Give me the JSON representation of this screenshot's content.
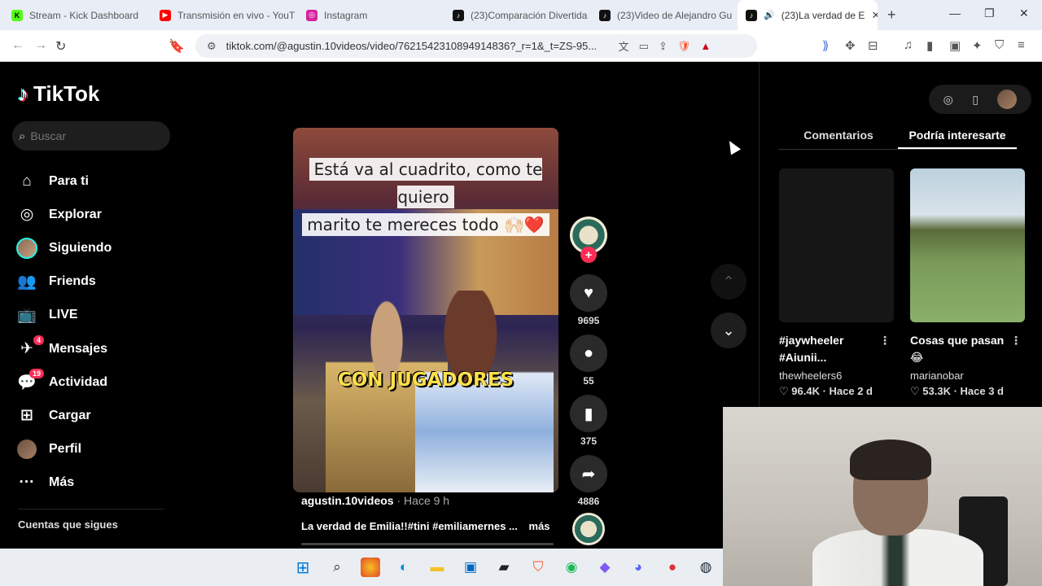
{
  "browser": {
    "tabs": [
      {
        "title": "Stream - Kick Dashboard",
        "fav_color": "#53fc18",
        "fav": "K"
      },
      {
        "title": "Transmisión en vivo - YouT",
        "fav_color": "#ff0000",
        "fav": "▶"
      },
      {
        "title": "Instagram",
        "fav_color": "#d6249f",
        "fav": "◎"
      },
      {
        "title": "(23)Comparación Divertida",
        "fav_color": "#111111",
        "fav": "♪"
      },
      {
        "title": "(23)Video de Alejandro Gu",
        "fav_color": "#111111",
        "fav": "♪"
      },
      {
        "title": "(23)La verdad de E",
        "fav_color": "#111111",
        "fav": "♪"
      }
    ],
    "url": "tiktok.com/@agustin.10videos/video/7621542310894914836?_r=1&_t=ZS-95..."
  },
  "tiktok": {
    "logo": "TikTok",
    "search_placeholder": "Buscar",
    "nav": [
      {
        "label": "Para ti",
        "icon": "⌂"
      },
      {
        "label": "Explorar",
        "icon": "◎"
      },
      {
        "label": "Siguiendo",
        "icon": ""
      },
      {
        "label": "Friends",
        "icon": "👥"
      },
      {
        "label": "LIVE",
        "icon": "📺"
      },
      {
        "label": "Mensajes",
        "icon": "✈",
        "badge": "4"
      },
      {
        "label": "Actividad",
        "icon": "💬",
        "badge": "19"
      },
      {
        "label": "Cargar",
        "icon": "⊞"
      },
      {
        "label": "Perfil",
        "icon": ""
      },
      {
        "label": "Más",
        "icon": "···"
      }
    ],
    "following_title": "Cuentas que sigues"
  },
  "video": {
    "caption_line1": "Está va al cuadrito, como te quiero",
    "caption_line2": "marito te mereces todo 🙌🏻❤️",
    "overlay_text": "CON JUGADORES",
    "author": "agustin.10videos",
    "time": "Hace 9 h",
    "description": "La verdad de Emilia!!#tini #emiliamernes ...",
    "more": "más",
    "likes": "9695",
    "comments": "55",
    "saves": "375",
    "shares": "4886"
  },
  "panel": {
    "tab_comments": "Comentarios",
    "tab_suggested": "Podría interesarte",
    "cards": [
      {
        "title": "#jaywheeler #Aiunii...",
        "user": "thewheelers6",
        "meta": "♡ 96.4K · Hace 2 d"
      },
      {
        "title": "Cosas que pasan 😂",
        "user": "marianobar",
        "meta": "♡ 53.3K · Hace 3 d"
      }
    ]
  }
}
